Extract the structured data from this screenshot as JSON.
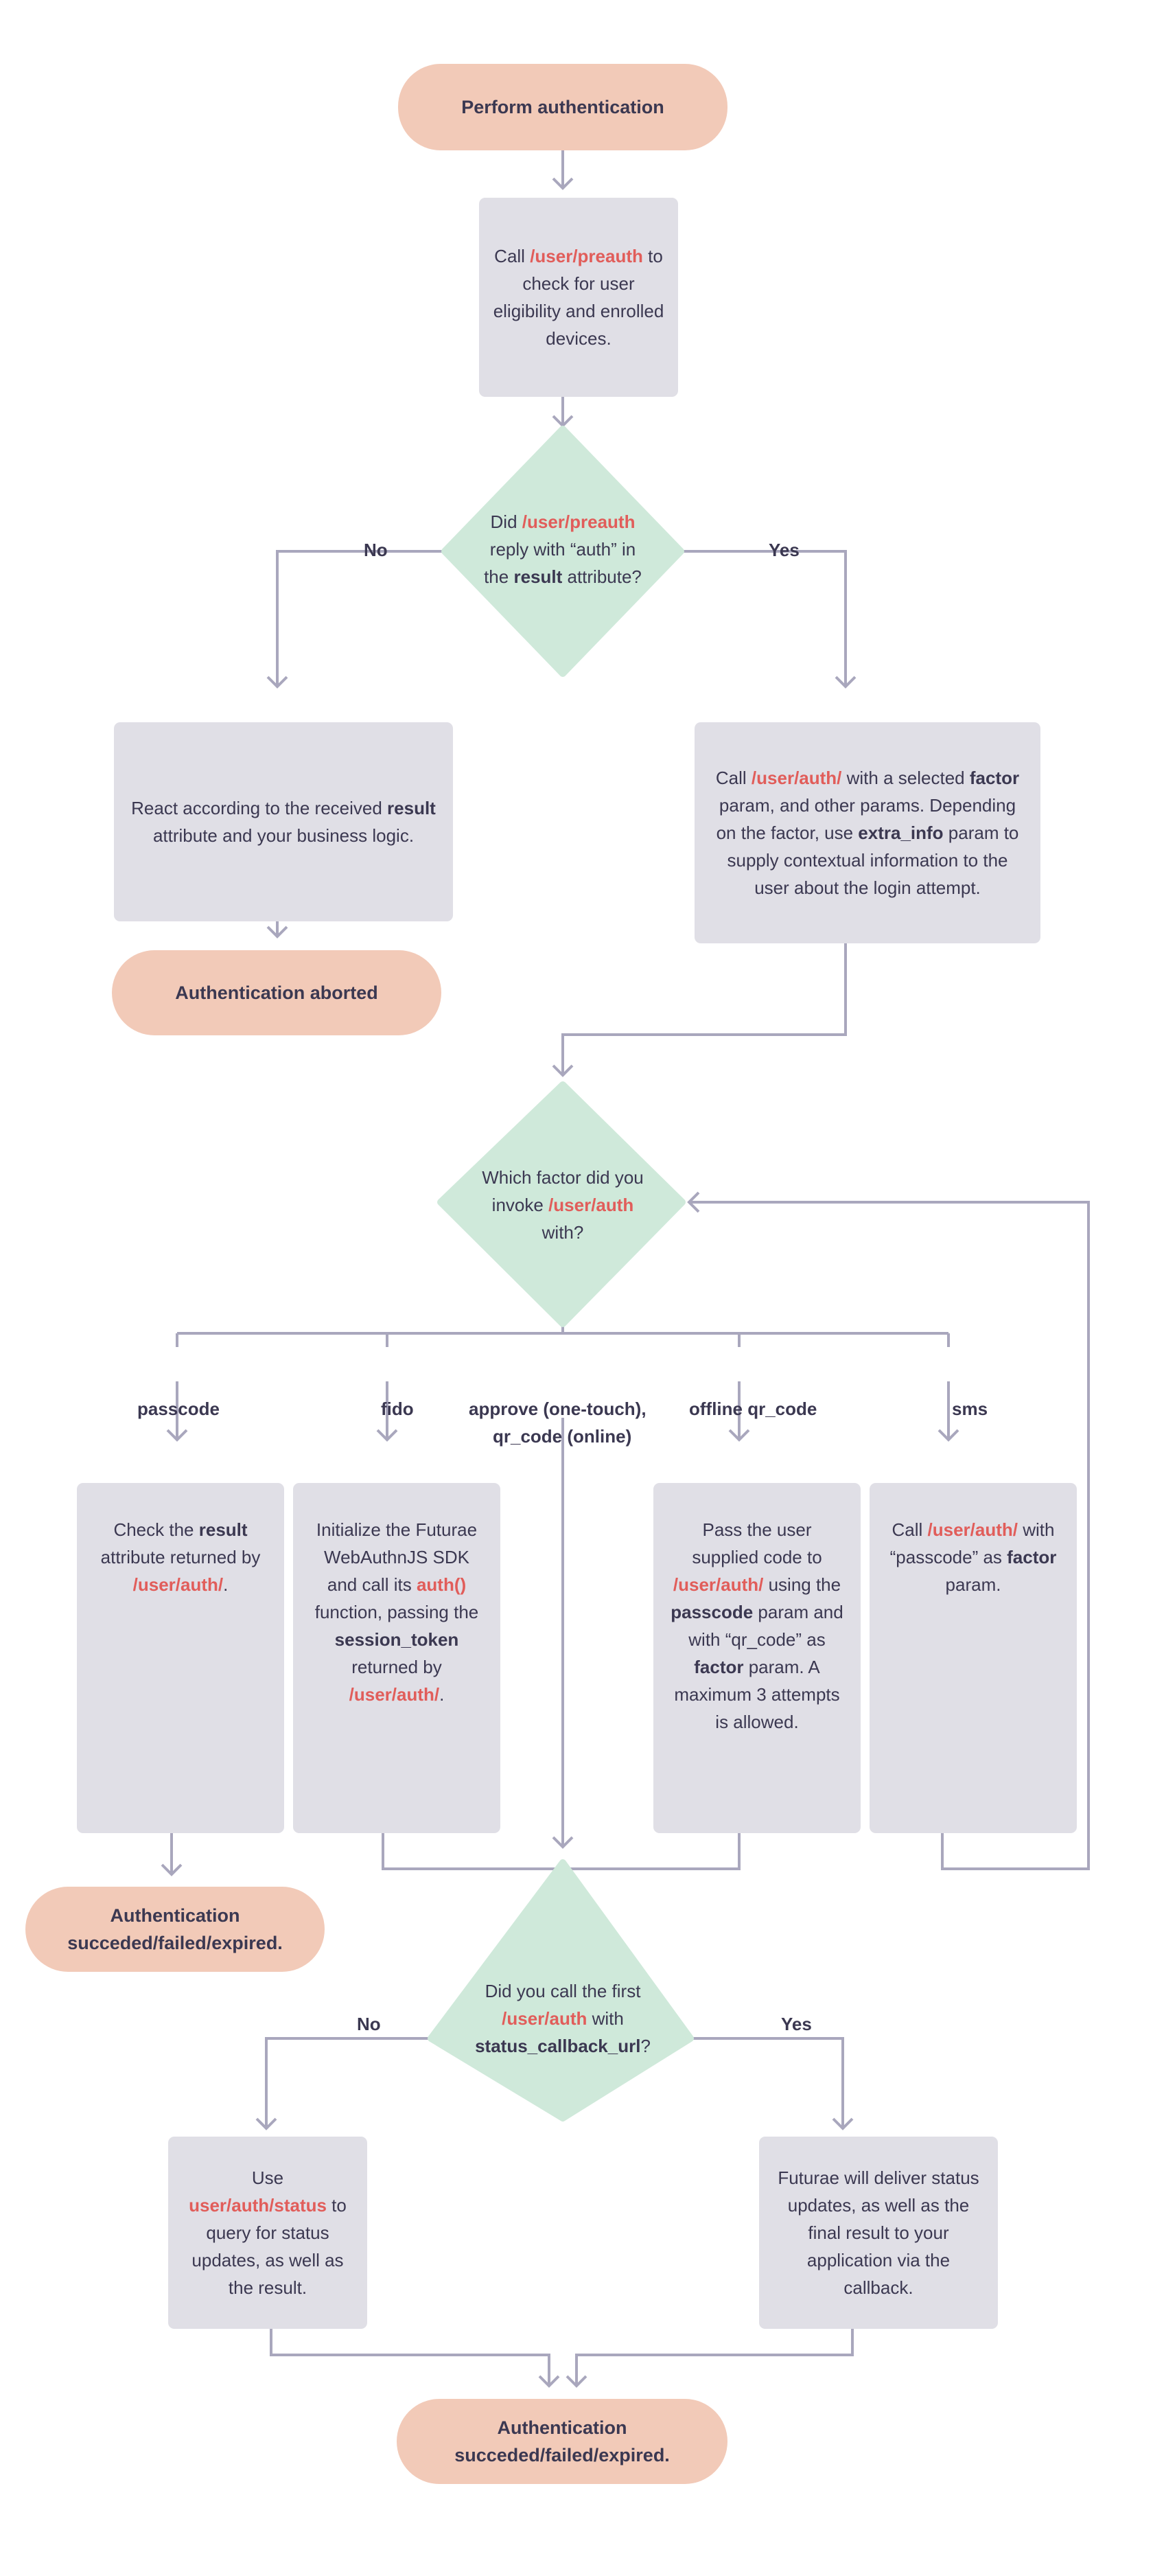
{
  "colors": {
    "terminal": "#f2cab8",
    "process": "#e0dfe6",
    "decision": "#cfe9da",
    "connector": "#a9a7bd",
    "text": "#3b3851",
    "highlight": "#e15d5a"
  },
  "nodes": {
    "start": {
      "text": "Perform authentication"
    },
    "preauth": {
      "parts": [
        {
          "t": "Call "
        },
        {
          "t": "/user/preauth",
          "s": "red"
        },
        {
          "t": " to check for user eligibility and enrolled devices."
        }
      ]
    },
    "decision_preauth": {
      "parts": [
        {
          "t": "Did "
        },
        {
          "t": "/user/preauth",
          "s": "red"
        },
        {
          "t": " reply with “auth” in the "
        },
        {
          "t": "result",
          "s": "b"
        },
        {
          "t": " attribute?"
        }
      ]
    },
    "react": {
      "parts": [
        {
          "t": "React according to the received "
        },
        {
          "t": "result",
          "s": "b"
        },
        {
          "t": " attribute and your business logic."
        }
      ]
    },
    "aborted": {
      "text": "Authentication aborted"
    },
    "call_auth": {
      "parts": [
        {
          "t": "Call "
        },
        {
          "t": "/user/auth/",
          "s": "red"
        },
        {
          "t": " with a selected "
        },
        {
          "t": "factor",
          "s": "b"
        },
        {
          "t": " param, and other params. Depending on the factor, use "
        },
        {
          "t": "extra_info",
          "s": "b"
        },
        {
          "t": " param to supply contextual information to the user about the login attempt."
        }
      ]
    },
    "decision_factor": {
      "parts": [
        {
          "t": "Which factor did you invoke "
        },
        {
          "t": "/user/auth",
          "s": "red"
        },
        {
          "t": " with?"
        }
      ]
    },
    "passcode_box": {
      "parts": [
        {
          "t": "Check the "
        },
        {
          "t": "result",
          "s": "b"
        },
        {
          "t": " attribute returned by "
        },
        {
          "t": "/user/auth/",
          "s": "red"
        },
        {
          "t": "."
        }
      ]
    },
    "fido_box": {
      "parts": [
        {
          "t": "Initialize the Futurae WebAuthnJS SDK and call its "
        },
        {
          "t": "auth()",
          "s": "red"
        },
        {
          "t": " function, passing the "
        },
        {
          "t": "session_token",
          "s": "b"
        },
        {
          "t": " returned by "
        },
        {
          "t": "/user/auth/",
          "s": "red"
        },
        {
          "t": "."
        }
      ]
    },
    "offline_box": {
      "parts": [
        {
          "t": "Pass the user supplied code to "
        },
        {
          "t": "/user/auth/",
          "s": "red"
        },
        {
          "t": " using the "
        },
        {
          "t": "passcode",
          "s": "b"
        },
        {
          "t": " param and with “qr_code” as "
        },
        {
          "t": "factor",
          "s": "b"
        },
        {
          "t": " param. A maximum 3 attempts is allowed."
        }
      ]
    },
    "sms_box": {
      "parts": [
        {
          "t": "Call "
        },
        {
          "t": "/user/auth/",
          "s": "red"
        },
        {
          "t": " with “passcode” as "
        },
        {
          "t": "factor",
          "s": "b"
        },
        {
          "t": " param."
        }
      ]
    },
    "result_left": {
      "text": "Authentication succeded/failed/expired."
    },
    "decision_callback": {
      "parts": [
        {
          "t": "Did you call the first "
        },
        {
          "t": "/user/auth",
          "s": "red"
        },
        {
          "t": " with "
        },
        {
          "t": "status_callback_url",
          "s": "b"
        },
        {
          "t": "?"
        }
      ]
    },
    "status_box": {
      "parts": [
        {
          "t": "Use "
        },
        {
          "t": "user/auth/status",
          "s": "red"
        },
        {
          "t": " to query for status updates, as well as the result."
        }
      ]
    },
    "callback_box": {
      "parts": [
        {
          "t": "Futurae will deliver status updates, as well as the final result to your application via the callback."
        }
      ]
    },
    "result_final": {
      "text": "Authentication succeded/failed/expired."
    }
  },
  "edge_labels": {
    "preauth_no": "No",
    "preauth_yes": "Yes",
    "factor_passcode": "passcode",
    "factor_fido": "fido",
    "factor_approve_1": "approve (one-touch),",
    "factor_approve_2": "qr_code (online)",
    "factor_offline": "offline qr_code",
    "factor_sms": "sms",
    "callback_no": "No",
    "callback_yes": "Yes"
  }
}
